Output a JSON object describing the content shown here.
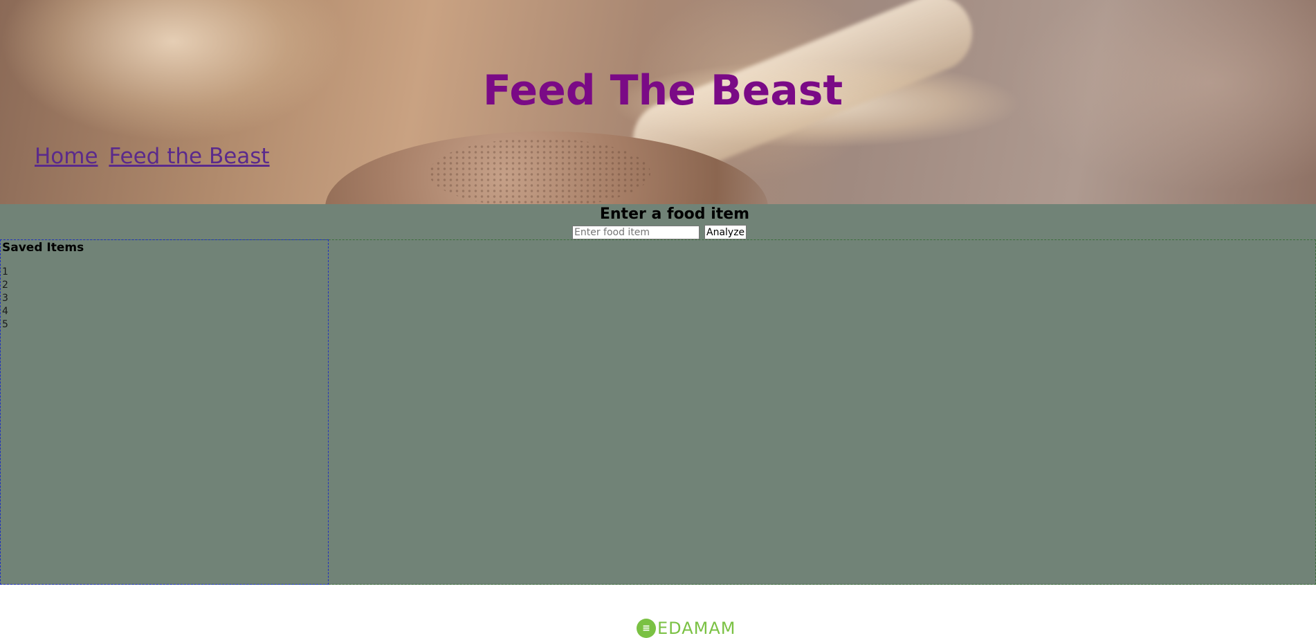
{
  "header": {
    "site_title": "Feed The Beast",
    "nav": [
      {
        "label": "Home"
      },
      {
        "label": "Feed the Beast"
      }
    ]
  },
  "search": {
    "heading": "Enter a food item",
    "placeholder": "Enter food item",
    "value": "",
    "button_label": "Analyze"
  },
  "saved": {
    "title": "Saved Items",
    "items": [
      "1",
      "2",
      "3",
      "4",
      "5"
    ]
  },
  "footer": {
    "logo_text": "EDAMAM",
    "logo_icon": "edamam-logo-icon"
  },
  "colors": {
    "title": "#7a0a86",
    "nav_link": "#5a2a8c",
    "main_bg": "#718377",
    "saved_border": "#2030c0",
    "results_border": "#3b6e3b",
    "logo": "#7ac143"
  }
}
